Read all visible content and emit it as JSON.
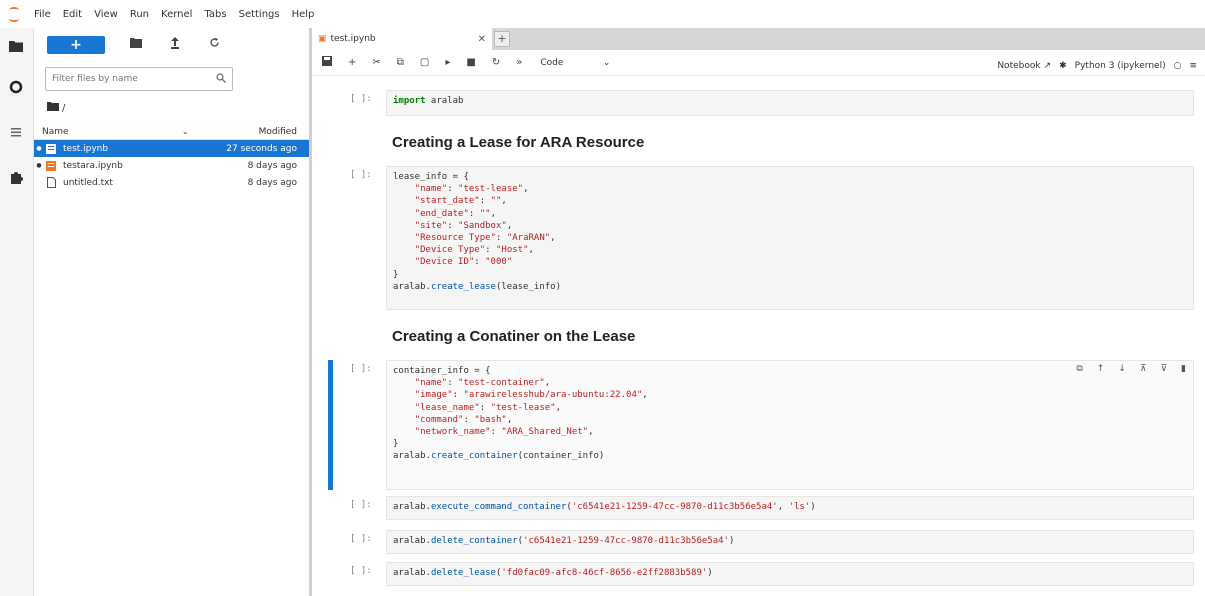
{
  "menu": [
    "File",
    "Edit",
    "View",
    "Run",
    "Kernel",
    "Tabs",
    "Settings",
    "Help"
  ],
  "file_browser": {
    "new_label": "+",
    "filter_placeholder": "Filter files by name",
    "path": "/",
    "col_name": "Name",
    "col_modified": "Modified",
    "files": [
      {
        "name": "test.ipynb",
        "modified": "27 seconds ago",
        "selected": true,
        "running": true,
        "kind": "notebook"
      },
      {
        "name": "testara.ipynb",
        "modified": "8 days ago",
        "selected": false,
        "running": true,
        "kind": "notebook"
      },
      {
        "name": "untitled.txt",
        "modified": "8 days ago",
        "selected": false,
        "running": false,
        "kind": "text"
      }
    ]
  },
  "tab": {
    "label": "test.ipynb"
  },
  "toolbar": {
    "cell_type": "Code",
    "notebook_label": "Notebook",
    "kernel_label": "Python 3 (ipykernel)"
  },
  "cells": [
    {
      "prompt": "[ ]:",
      "code": "import aralab"
    },
    {
      "heading": "Creating a Lease for ARA Resource"
    },
    {
      "prompt": "[ ]:",
      "code": "lease_info = {\n    \"name\": \"test-lease\",\n    \"start_date\": \"\",\n    \"end_date\": \"\",\n    \"site\": \"Sandbox\",\n    \"Resource Type\": \"AraRAN\",\n    \"Device Type\": \"Host\",\n    \"Device ID\": \"000\"\n}\naralab.create_lease(lease_info)"
    },
    {
      "heading": "Creating a Conatiner on the Lease"
    },
    {
      "prompt": "[ ]:",
      "code": "container_info = {\n    \"name\": \"test-container\",\n    \"image\": \"arawirelesshub/ara-ubuntu:22.04\",\n    \"lease_name\": \"test-lease\",\n    \"command\": \"bash\",\n    \"network_name\": \"ARA_Shared_Net\",\n}\naralab.create_container(container_info)"
    },
    {
      "prompt": "[ ]:",
      "code": "aralab.execute_command_container('c6541e21-1259-47cc-9870-d11c3b56e5a4', 'ls')"
    },
    {
      "prompt": "[ ]:",
      "code": "aralab.delete_container('c6541e21-1259-47cc-9870-d11c3b56e5a4')"
    },
    {
      "prompt": "[ ]:",
      "code": "aralab.delete_lease('fd0fac09-afc8-46cf-8656-e2ff2883b589')"
    }
  ],
  "colors": {
    "accent": "#1976d2",
    "notebook_orange": "#f37726"
  }
}
